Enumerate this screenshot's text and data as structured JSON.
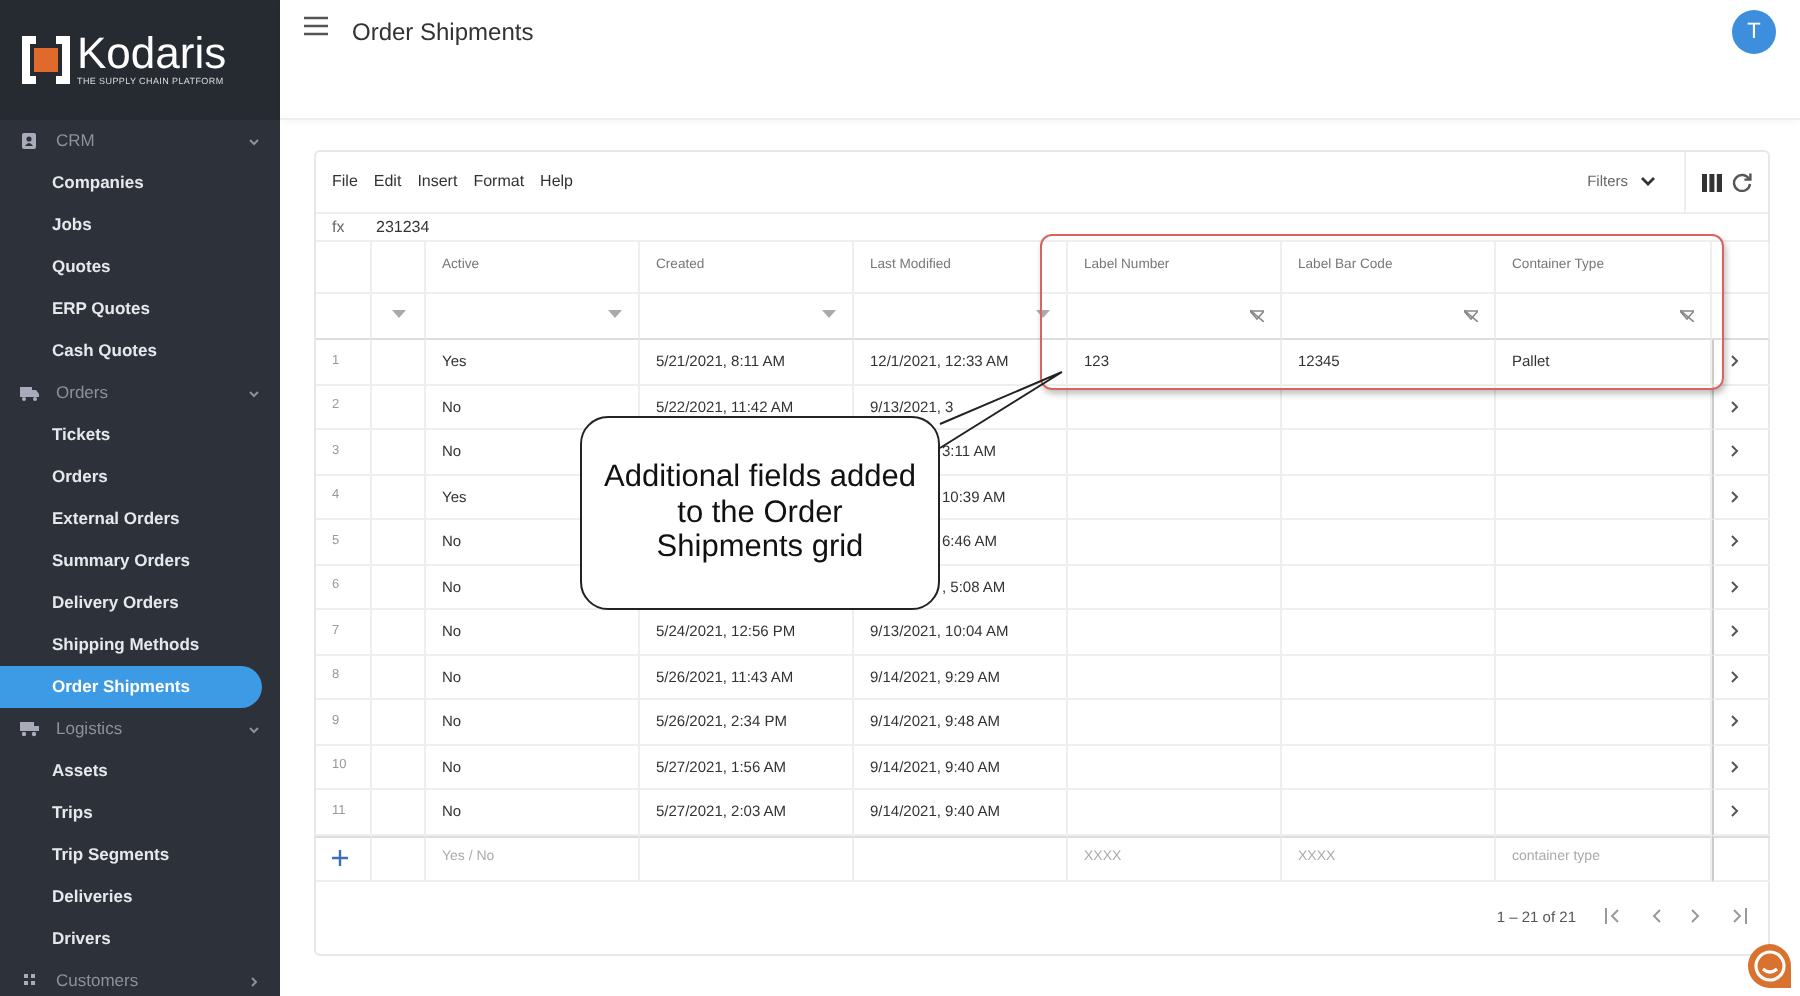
{
  "logo": {
    "name": "Kodaris",
    "tagline": "THE SUPPLY CHAIN PLATFORM"
  },
  "page_title": "Order Shipments",
  "avatar": "T",
  "sidebar": {
    "sections": [
      {
        "label": "CRM",
        "expanded": true,
        "items": [
          {
            "label": "Companies",
            "selected": false
          },
          {
            "label": "Jobs",
            "selected": false
          },
          {
            "label": "Quotes",
            "selected": false
          },
          {
            "label": "ERP Quotes",
            "selected": false
          },
          {
            "label": "Cash Quotes",
            "selected": false
          }
        ]
      },
      {
        "label": "Orders",
        "expanded": true,
        "items": [
          {
            "label": "Tickets",
            "selected": false
          },
          {
            "label": "Orders",
            "selected": false
          },
          {
            "label": "External Orders",
            "selected": false
          },
          {
            "label": "Summary Orders",
            "selected": false
          },
          {
            "label": "Delivery Orders",
            "selected": false
          },
          {
            "label": "Shipping Methods",
            "selected": false
          },
          {
            "label": "Order Shipments",
            "selected": true
          }
        ]
      },
      {
        "label": "Logistics",
        "expanded": true,
        "items": [
          {
            "label": "Assets",
            "selected": false
          },
          {
            "label": "Trips",
            "selected": false
          },
          {
            "label": "Trip Segments",
            "selected": false
          },
          {
            "label": "Deliveries",
            "selected": false
          },
          {
            "label": "Drivers",
            "selected": false
          }
        ]
      },
      {
        "label": "Customers",
        "expanded": false
      }
    ]
  },
  "grid": {
    "menu": [
      "File",
      "Edit",
      "Insert",
      "Format",
      "Help"
    ],
    "filters_button": "Filters",
    "formula_bar": {
      "label": "fx",
      "value": "231234"
    },
    "columns": [
      {
        "label": "Active",
        "highlighted": false
      },
      {
        "label": "Created",
        "highlighted": false
      },
      {
        "label": "Last Modified",
        "highlighted": false
      },
      {
        "label": "Label Number",
        "highlighted": true
      },
      {
        "label": "Label Bar Code",
        "highlighted": true
      },
      {
        "label": "Container Type",
        "highlighted": true
      }
    ],
    "rows": [
      {
        "number": "1",
        "active": "Yes",
        "created": "5/21/2021, 8:11 AM",
        "last_modified": "12/1/2021, 12:33 AM",
        "label_number": "123",
        "label_bar_code": "12345",
        "container_type": "Pallet"
      },
      {
        "number": "2",
        "active": "No",
        "created": "5/22/2021, 11:42 AM",
        "last_modified": "9/13/2021, 3"
      },
      {
        "number": "3",
        "active": "No",
        "last_modified": "3:11 AM"
      },
      {
        "number": "4",
        "active": "Yes",
        "last_modified": "10:39 AM"
      },
      {
        "number": "5",
        "active": "No",
        "last_modified": "6:46 AM"
      },
      {
        "number": "6",
        "active": "No",
        "last_modified": ", 5:08 AM"
      },
      {
        "number": "7",
        "active": "No",
        "created": "5/24/2021, 12:56 PM",
        "last_modified": "9/13/2021, 10:04 AM"
      },
      {
        "number": "8",
        "active": "No",
        "created": "5/26/2021, 11:43 AM",
        "last_modified": "9/14/2021, 9:29 AM"
      },
      {
        "number": "9",
        "active": "No",
        "created": "5/26/2021, 2:34 PM",
        "last_modified": "9/14/2021, 9:48 AM"
      },
      {
        "number": "10",
        "active": "No",
        "created": "5/27/2021, 1:56 AM",
        "last_modified": "9/14/2021, 9:40 AM"
      },
      {
        "number": "11",
        "active": "No",
        "created": "5/27/2021, 2:03 AM",
        "last_modified": "9/14/2021, 9:40 AM"
      }
    ],
    "new_row": {
      "active": "Yes / No",
      "label_number": "XXXX",
      "label_bar_code": "XXXX",
      "container_type": "container type"
    },
    "pagination": "1 – 21 of 21"
  },
  "callout": "Additional fields added to the Order Shipments grid"
}
